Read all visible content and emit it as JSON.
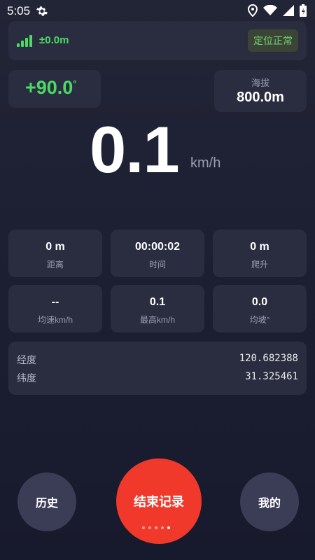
{
  "status_bar": {
    "time": "5:05",
    "icons": [
      "settings-icon",
      "location-icon",
      "wifi-icon",
      "signal-icon",
      "battery-icon"
    ]
  },
  "gps": {
    "accuracy": "±0.0m",
    "signal_bars": 4,
    "status": "定位正常"
  },
  "heading": {
    "value": "+90.0",
    "unit": "°"
  },
  "altitude": {
    "label": "海拔",
    "value": "800.0m"
  },
  "speed": {
    "value": "0.1",
    "unit": "km/h"
  },
  "stats": [
    {
      "value": "0 m",
      "label": "距离"
    },
    {
      "value": "00:00:02",
      "label": "时间"
    },
    {
      "value": "0 m",
      "label": "爬升"
    },
    {
      "value": "--",
      "label": "均速km/h"
    },
    {
      "value": "0.1",
      "label": "最高km/h"
    },
    {
      "value": "0.0",
      "label": "均坡°"
    }
  ],
  "coords": {
    "lon_label": "经度",
    "lon": "120.682388",
    "lat_label": "纬度",
    "lat": "31.325461"
  },
  "buttons": {
    "history": "历史",
    "stop": "结束记录",
    "mine": "我的"
  },
  "pager": {
    "count": 5,
    "active": 5
  },
  "colors": {
    "accent_green": "#4cd964",
    "stop_red": "#f0392b",
    "card": "#2a2d40"
  }
}
